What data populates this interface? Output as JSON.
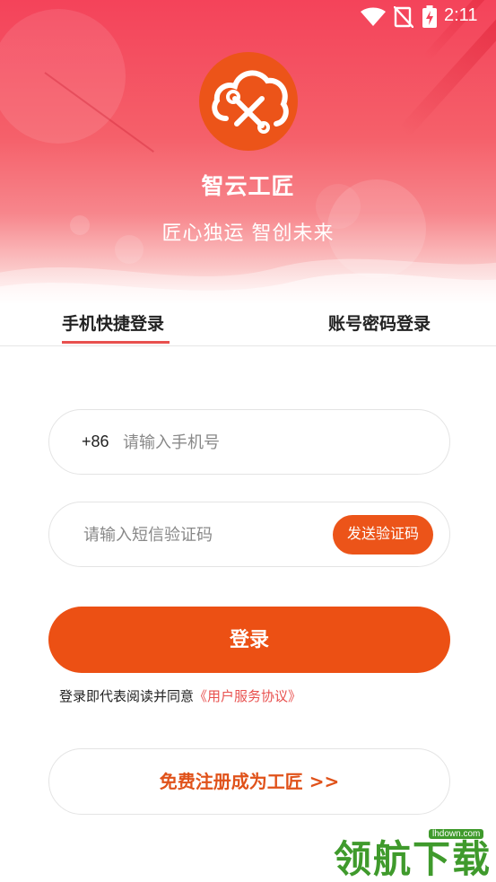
{
  "status_bar": {
    "time": "2:11",
    "wifi_icon": "wifi-icon",
    "signal_icon": "no-signal-icon",
    "battery_icon": "battery-charging-icon"
  },
  "brand": {
    "logo_icon": "cloud-tools-icon",
    "app_name": "智云工匠",
    "slogan": "匠心独运 智创未来"
  },
  "tabs": [
    {
      "label": "手机快捷登录",
      "active": true
    },
    {
      "label": "账号密码登录",
      "active": false
    }
  ],
  "form": {
    "phone_prefix": "+86",
    "phone_placeholder": "请输入手机号",
    "code_placeholder": "请输入短信验证码",
    "send_code_label": "发送验证码",
    "login_label": "登录",
    "agreement_text": "登录即代表阅读并同意",
    "agreement_link": "《用户服务协议》",
    "register_label": "免费注册成为工匠 >>"
  },
  "watermark": {
    "text": "领航下载",
    "domain": "lhdown.com"
  },
  "colors": {
    "accent": "#ec5419",
    "header_red": "#f4435a",
    "tab_underline": "#e8504e",
    "link": "#e8504e"
  }
}
